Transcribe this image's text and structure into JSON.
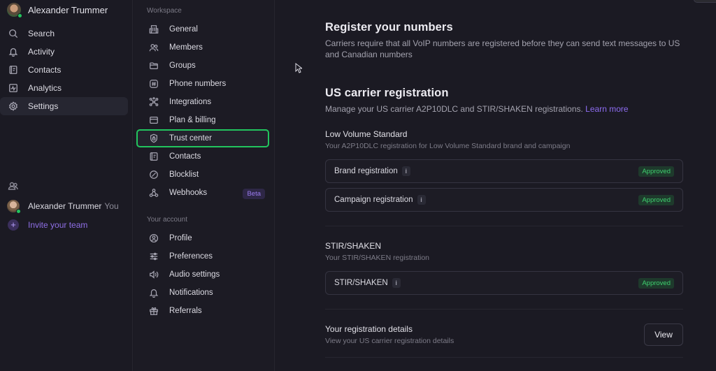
{
  "sidebar": {
    "user_name": "Alexander Trummer",
    "items": [
      {
        "label": "Search",
        "icon": "search-icon"
      },
      {
        "label": "Activity",
        "icon": "bell-icon"
      },
      {
        "label": "Contacts",
        "icon": "contacts-book-icon"
      },
      {
        "label": "Analytics",
        "icon": "analytics-icon"
      },
      {
        "label": "Settings",
        "icon": "gear-icon",
        "active": true
      }
    ],
    "team": {
      "member_name": "Alexander Trummer",
      "member_tag": "You",
      "invite_label": "Invite your team"
    }
  },
  "settings_nav": {
    "workspace_label": "Workspace",
    "workspace_items": [
      {
        "label": "General",
        "icon": "building-icon"
      },
      {
        "label": "Members",
        "icon": "users-icon"
      },
      {
        "label": "Groups",
        "icon": "folder-icon"
      },
      {
        "label": "Phone numbers",
        "icon": "hash-icon"
      },
      {
        "label": "Integrations",
        "icon": "integrations-icon"
      },
      {
        "label": "Plan & billing",
        "icon": "credit-card-icon"
      },
      {
        "label": "Trust center",
        "icon": "shield-lock-icon",
        "highlighted": true
      },
      {
        "label": "Contacts",
        "icon": "contacts-book-icon"
      },
      {
        "label": "Blocklist",
        "icon": "block-icon"
      },
      {
        "label": "Webhooks",
        "icon": "webhook-icon",
        "badge": "Beta"
      }
    ],
    "account_label": "Your account",
    "account_items": [
      {
        "label": "Profile",
        "icon": "user-circle-icon"
      },
      {
        "label": "Preferences",
        "icon": "sliders-icon"
      },
      {
        "label": "Audio settings",
        "icon": "speaker-icon"
      },
      {
        "label": "Notifications",
        "icon": "bell-icon"
      },
      {
        "label": "Referrals",
        "icon": "gift-icon"
      }
    ]
  },
  "main": {
    "register": {
      "title": "Register your numbers",
      "description": "Carriers require that all VoIP numbers are registered before they can send text messages to US and Canadian numbers"
    },
    "us_carrier": {
      "title": "US carrier registration",
      "description": "Manage your US carrier A2P10DLC and STIR/SHAKEN registrations.",
      "learn_more": "Learn more"
    },
    "low_volume": {
      "title": "Low Volume Standard",
      "description": "Your A2P10DLC registration for Low Volume Standard brand and campaign",
      "rows": [
        {
          "label": "Brand registration",
          "status": "Approved"
        },
        {
          "label": "Campaign registration",
          "status": "Approved"
        }
      ]
    },
    "stir_shaken": {
      "title": "STIR/SHAKEN",
      "description": "Your STIR/SHAKEN registration",
      "rows": [
        {
          "label": "STIR/SHAKEN",
          "status": "Approved"
        }
      ]
    },
    "details": {
      "title": "Your registration details",
      "description": "View your US carrier registration details",
      "button": "View"
    },
    "info_glyph": "i"
  },
  "colors": {
    "accent_purple": "#8d6cf0",
    "approved_green": "#3fcf6e",
    "highlight_green": "#22c55e",
    "background": "#1b1a23"
  }
}
